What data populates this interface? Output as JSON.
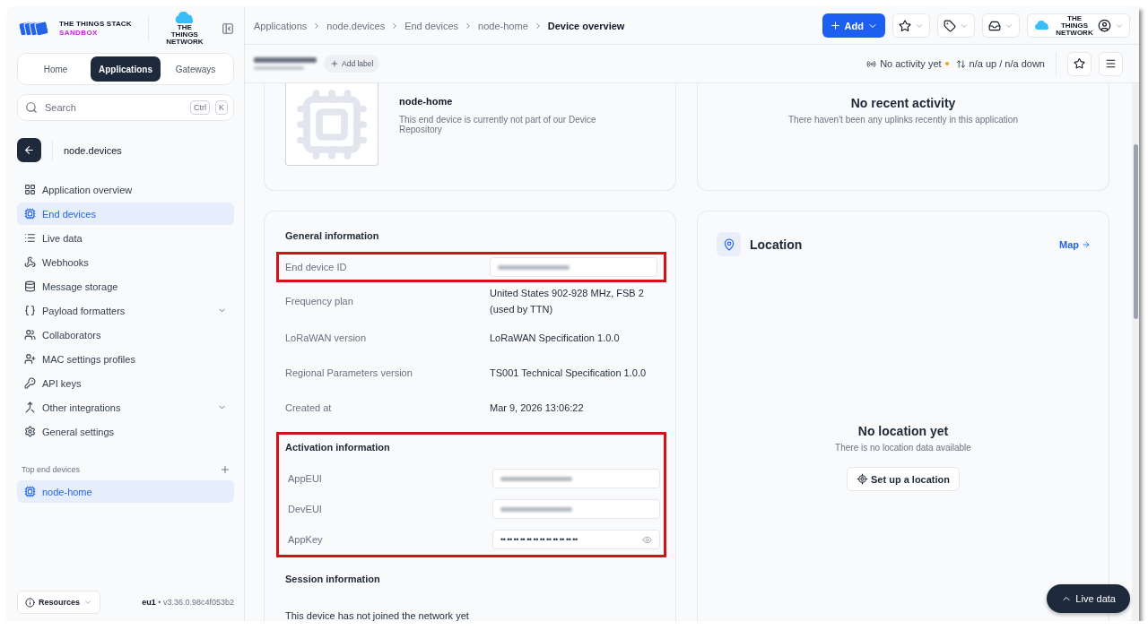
{
  "brand": {
    "title": "THE THINGS STACK",
    "subtitle": "SANDBOX",
    "network_logo": "THE THINGS NETWORK"
  },
  "nav_tabs": [
    {
      "label": "Home",
      "selected": false
    },
    {
      "label": "Applications",
      "selected": true
    },
    {
      "label": "Gateways",
      "selected": false
    }
  ],
  "search": {
    "placeholder": "Search",
    "shortcut": [
      "Ctrl",
      "K"
    ]
  },
  "application": {
    "name": "node.devices"
  },
  "sidebar": {
    "items": [
      {
        "label": "Application overview",
        "selected": false,
        "expandable": false
      },
      {
        "label": "End devices",
        "selected": true,
        "expandable": false
      },
      {
        "label": "Live data",
        "selected": false,
        "expandable": false
      },
      {
        "label": "Webhooks",
        "selected": false,
        "expandable": false
      },
      {
        "label": "Message storage",
        "selected": false,
        "expandable": false
      },
      {
        "label": "Payload formatters",
        "selected": false,
        "expandable": true
      },
      {
        "label": "Collaborators",
        "selected": false,
        "expandable": false
      },
      {
        "label": "MAC settings profiles",
        "selected": false,
        "expandable": false
      },
      {
        "label": "API keys",
        "selected": false,
        "expandable": false
      },
      {
        "label": "Other integrations",
        "selected": false,
        "expandable": true
      },
      {
        "label": "General settings",
        "selected": false,
        "expandable": false
      }
    ]
  },
  "top_devices": {
    "title": "Top end devices",
    "items": [
      {
        "label": "node-home",
        "selected": true
      }
    ]
  },
  "footer": {
    "resources": "Resources",
    "region": "eu1",
    "version": "• v3.36.0.98c4f053b2"
  },
  "breadcrumbs": [
    "Applications",
    "node.devices",
    "End devices",
    "node-home",
    "Device overview"
  ],
  "header_actions": {
    "add": "Add",
    "network_logo": "THE THINGS NETWORK"
  },
  "device_bar": {
    "add_label": "Add label",
    "activity": "No activity yet",
    "traffic": "n/a up / n/a down"
  },
  "device_card": {
    "name": "node-home",
    "description": "This end device is currently not part of our Device Repository"
  },
  "activity_card": {
    "title": "No recent activity",
    "text": "There haven't been any uplinks recently in this application"
  },
  "general": {
    "title": "General information",
    "rows": [
      {
        "label": "End device ID",
        "kind": "redacted",
        "highlighted": true
      },
      {
        "label": "Frequency plan",
        "kind": "text",
        "value": "United States 902-928 MHz, FSB 2 (used by TTN)",
        "highlighted": false
      },
      {
        "label": "LoRaWAN version",
        "kind": "text",
        "value": "LoRaWAN Specification 1.0.0",
        "highlighted": false
      },
      {
        "label": "Regional Parameters version",
        "kind": "text",
        "value": "TS001 Technical Specification 1.0.0",
        "highlighted": false
      },
      {
        "label": "Created at",
        "kind": "text",
        "value": "Mar 9, 2026 13:06:22",
        "highlighted": false
      }
    ]
  },
  "activation": {
    "title": "Activation information",
    "highlighted": true,
    "rows": [
      {
        "label": "AppEUI",
        "kind": "redacted",
        "highlighted": false
      },
      {
        "label": "DevEUI",
        "kind": "redacted",
        "highlighted": false
      },
      {
        "label": "AppKey",
        "kind": "secret",
        "value": "•• •• •• •• •• •• •• •• •• •• •• ••",
        "highlighted": false
      }
    ]
  },
  "session": {
    "title": "Session information",
    "text": "This device has not joined the network yet"
  },
  "location": {
    "title": "Location",
    "link": "Map",
    "empty_title": "No location yet",
    "empty_text": "There is no location data available",
    "button": "Set up a location"
  },
  "live_data": {
    "label": "Live data"
  }
}
